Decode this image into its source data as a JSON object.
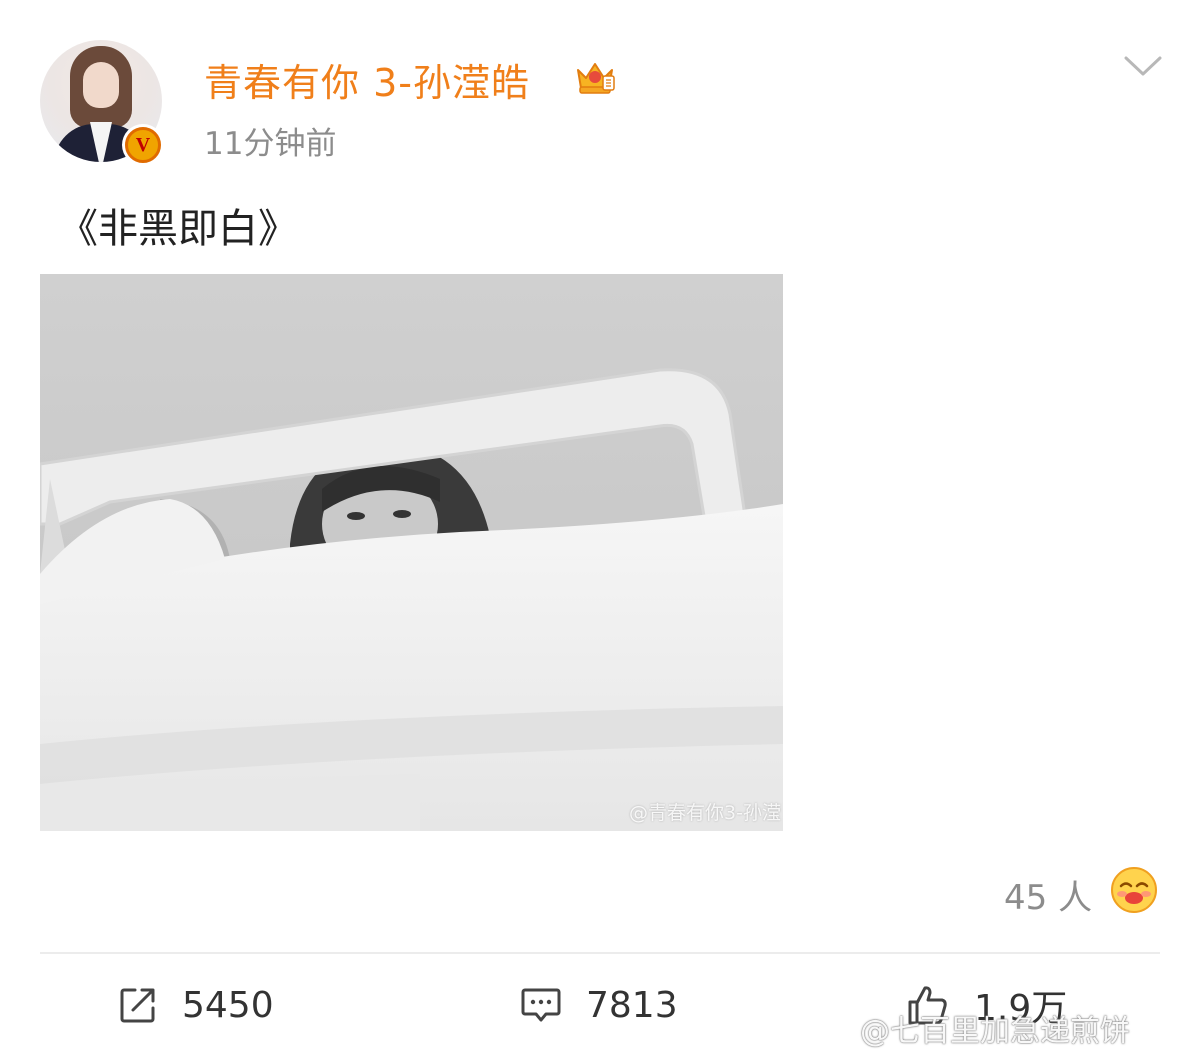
{
  "header": {
    "username": "青春有你 3-孙滢皓",
    "timestamp": "11分钟前",
    "verified_badge": "V"
  },
  "post": {
    "text": "《非黑即白》",
    "image_watermark": "@青春有你3-孙滢"
  },
  "reactions": {
    "count_label": "45 人",
    "emoji_icon": "adore-emoji-icon"
  },
  "actions": {
    "repost_count": "5450",
    "comment_count": "7813",
    "like_count": "1.9万"
  },
  "overlay_watermark": "@七百里加急递煎饼",
  "colors": {
    "username": "#f07f1a",
    "muted": "#8c8c8c",
    "text": "#222222",
    "divider": "#ececec"
  }
}
